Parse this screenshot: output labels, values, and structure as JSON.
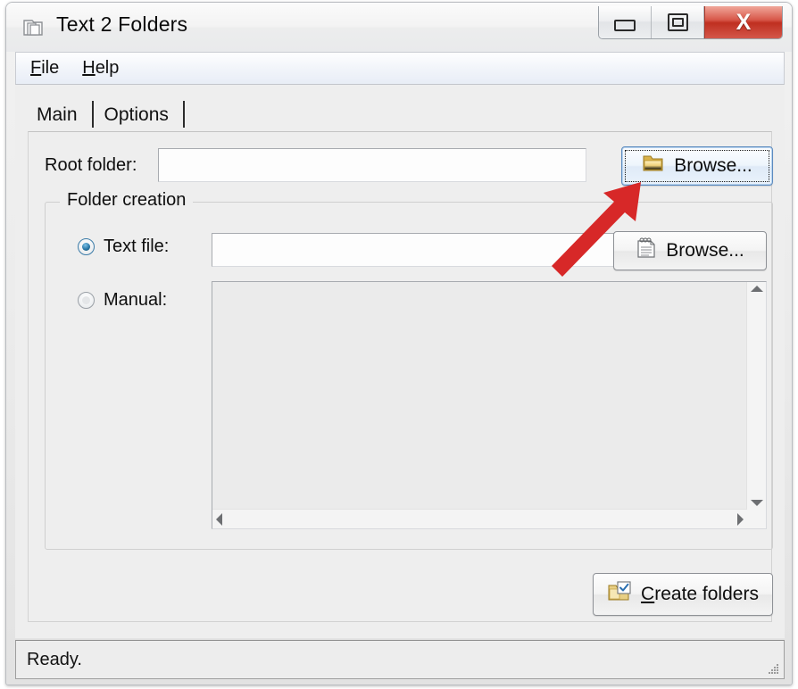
{
  "window": {
    "title": "Text 2 Folders",
    "icon": "folder-stack-icon",
    "caption_buttons": {
      "minimize_label": "–",
      "restore_label": "❐",
      "close_label": "X"
    },
    "accent_close_color": "#bf2f20"
  },
  "menu": {
    "items": [
      {
        "label": "File",
        "accelerator": "F"
      },
      {
        "label": "Help",
        "accelerator": "H"
      }
    ]
  },
  "tabs": [
    {
      "label": "Main",
      "selected": true
    },
    {
      "label": "Options",
      "selected": false
    }
  ],
  "main_tab": {
    "root_folder": {
      "label": "Root folder:",
      "value": "",
      "placeholder": "",
      "browse_button": {
        "label": "Browse...",
        "icon": "folder-icon",
        "focused": true
      }
    },
    "folder_creation": {
      "title": "Folder creation",
      "text_file_option": {
        "label": "Text file:",
        "checked": true,
        "value": "",
        "placeholder": "",
        "browse_button": {
          "label": "Browse...",
          "icon": "notepad-icon",
          "focused": false
        }
      },
      "manual_option": {
        "label": "Manual:",
        "checked": false,
        "value": "",
        "disabled": true,
        "scrollbars": {
          "up_arrow": "scroll-up-icon",
          "down_arrow": "scroll-down-icon",
          "left_arrow": "scroll-left-icon",
          "right_arrow": "scroll-right-icon"
        }
      }
    },
    "create_button": {
      "label": "Create folders",
      "accelerator": "C",
      "icon": "folder-check-icon"
    }
  },
  "statusbar": {
    "text": "Ready.",
    "grip": "resize-grip-icon"
  },
  "annotation": {
    "arrow": "red-pointer-arrow",
    "color": "#d72828",
    "points_to": "root-folder-browse-button"
  }
}
